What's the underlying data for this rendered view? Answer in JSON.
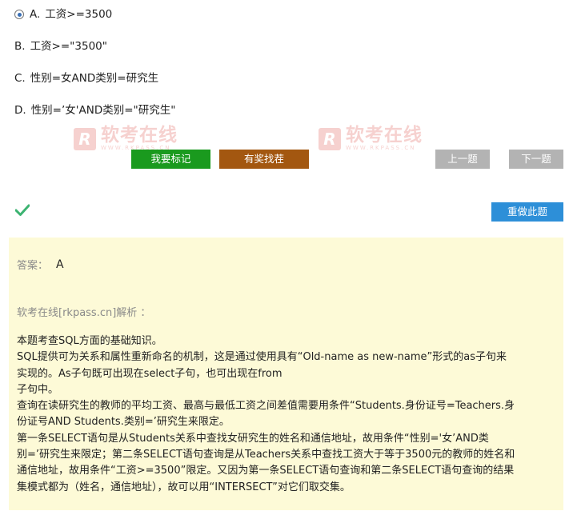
{
  "options": [
    {
      "letter": "A.",
      "text": "工资>=3500",
      "selected": true
    },
    {
      "letter": "B.",
      "text": "工资>=\"3500\"",
      "selected": false
    },
    {
      "letter": "C.",
      "text": "性别=女AND类别=研究生",
      "selected": false
    },
    {
      "letter": "D.",
      "text": "性别=’女'AND类别=\"研究生\"",
      "selected": false
    }
  ],
  "watermark": {
    "cn": "软考在线",
    "en": "WWW.RKPASS.CN",
    "logo": "R"
  },
  "buttons": {
    "mark": "我要标记",
    "report": "有奖找茬",
    "prev": "上一题",
    "next": "下一题",
    "redo": "重做此题"
  },
  "result_icon": "checkmark-icon",
  "colors": {
    "mark": "#1a9a1e",
    "report": "#a35710",
    "nav": "#b3b3b3",
    "redo": "#2d8fd8",
    "check": "#3cb371",
    "panel": "#fdfad7"
  },
  "answer": {
    "label": "答案：",
    "value": "A"
  },
  "analysis": {
    "title": "软考在线[rkpass.cn]解析 ：",
    "lines": [
      "本题考查SQL方面的基础知识。",
      "SQL提供可为关系和属性重新命名的机制，这是通过使用具有“Old-name as new-name”形式的as子句来",
      "实现的。As子句既可出现在select子句，也可出现在from",
      "子句中。",
      "查询在读研究生的教师的平均工资、最高与最低工资之间差值需要用条件“Students.身份证号=Teachers.身",
      "份证号AND Students.类别=’研究生来限定。",
      "第一条SELECT语句是从Students关系中查找女研究生的姓名和通信地址，故用条件“性别='女’AND类",
      "别=’研究生来限定；第二条SELECT语句查询是从Teachers关系中查找工资大于等于3500元的教师的姓名和",
      "通信地址，故用条件“工资>=3500”限定。又因为第一条SELECT语句查询和第二条SELECT语句查询的结果",
      "集模式都为（姓名，通信地址），故可以用“INTERSECT”对它们取交集。"
    ]
  }
}
